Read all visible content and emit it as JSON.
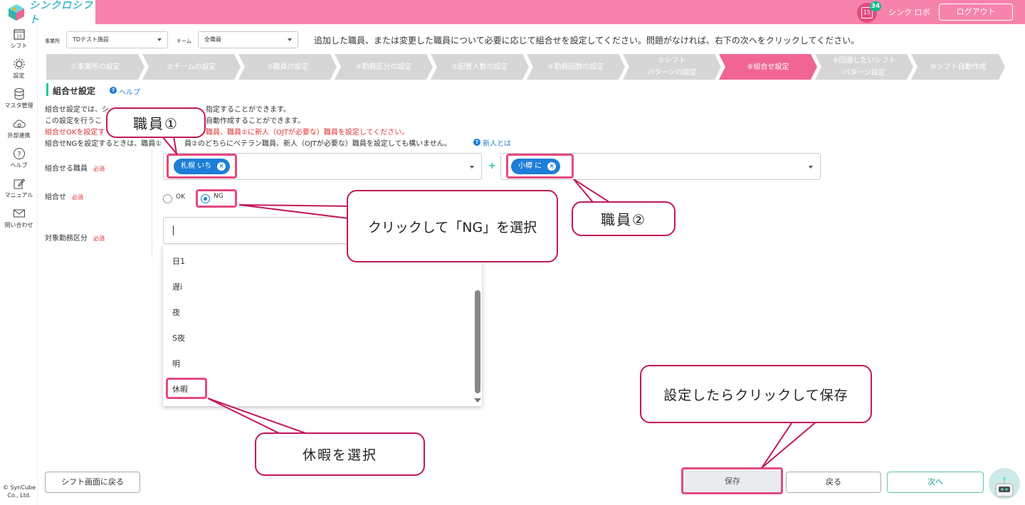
{
  "header": {
    "logo_text": "シンクロシフト",
    "calendar_day": "15",
    "notification_count": "34",
    "user_name": "シンク ロボ",
    "logout_label": "ログアウト",
    "brand_color": "#f783ac"
  },
  "sidebar": {
    "items": [
      {
        "label": "シフト",
        "icon": "calendar-icon",
        "cal_day": "15"
      },
      {
        "label": "設定",
        "icon": "gear-icon"
      },
      {
        "label": "マスタ管理",
        "icon": "database-icon"
      },
      {
        "label": "外部連携",
        "icon": "cloud-sync-icon"
      },
      {
        "label": "ヘルプ",
        "icon": "question-icon"
      },
      {
        "label": "マニュアル",
        "icon": "edit-icon"
      },
      {
        "label": "問い合わせ",
        "icon": "mail-icon"
      }
    ],
    "copyright_line1": "© SynCube",
    "copyright_line2": "Co., Ltd."
  },
  "filters": {
    "office_label": "事業所",
    "office_value": "TDテスト施設",
    "team_label": "チーム",
    "team_value": "全職員",
    "message": "追加した職員、または変更した職員について必要に応じて組合せを設定してください。問題がなければ、右下の次へをクリックしてください。"
  },
  "steps": [
    {
      "label": "①事業所の設定",
      "active": false
    },
    {
      "label": "②チームの設定",
      "active": false
    },
    {
      "label": "③職員の設定",
      "active": false
    },
    {
      "label": "④勤務区分の設定",
      "active": false
    },
    {
      "label": "⑤配置人数の設定",
      "active": false
    },
    {
      "label": "⑥勤務回数の設定",
      "active": false
    },
    {
      "label": "⑦シフト\nパターンの設定",
      "active": false
    },
    {
      "label": "⑧組合せ設定",
      "active": true
    },
    {
      "label": "⑨回避したいシフト\nパターン設定",
      "active": false
    },
    {
      "label": "⑩シフト自動作成",
      "active": false
    }
  ],
  "section": {
    "title": "組合せ設定",
    "help_label": "ヘルプ",
    "desc1": "組合せ設定では、シ",
    "desc1b": "指定することができます。",
    "desc2": "この設定を行うこ",
    "desc2b": "自動作成することができます。",
    "desc3": "組合せOKを設定す",
    "desc3b": "職員、職員②に新人（OJTが必要な）職員を設定してください。",
    "desc4": "組合せNGを設定するときは、職員①",
    "desc4b": "員②のどちらにベテラン職員、新人（OJTが必要な）職員を設定しても構いません。",
    "new_link": "新人とは"
  },
  "form": {
    "staff_label": "組合せる職員",
    "required": "必須",
    "staff1_chip": "札幌 いち",
    "staff2_chip": "小樽 に",
    "plus": "+",
    "combo_label": "組合せ",
    "ok_label": "OK",
    "ng_label": "NG",
    "selected_combo": "NG",
    "shift_label": "対象勤務区分",
    "shift_input_value": "",
    "options": [
      "日1",
      "遅i",
      "夜",
      "S夜",
      "明",
      "休暇"
    ]
  },
  "buttons": {
    "back_to_shift": "シフト画面に戻る",
    "save": "保存",
    "back": "戻る",
    "next": "次へ"
  },
  "callouts": {
    "staff1": "職員①",
    "staff2": "職員②",
    "click_ng": "クリックして「NG」を選択",
    "select_holiday": "休暇を選択",
    "save_hint": "設定したらクリックして保存"
  }
}
